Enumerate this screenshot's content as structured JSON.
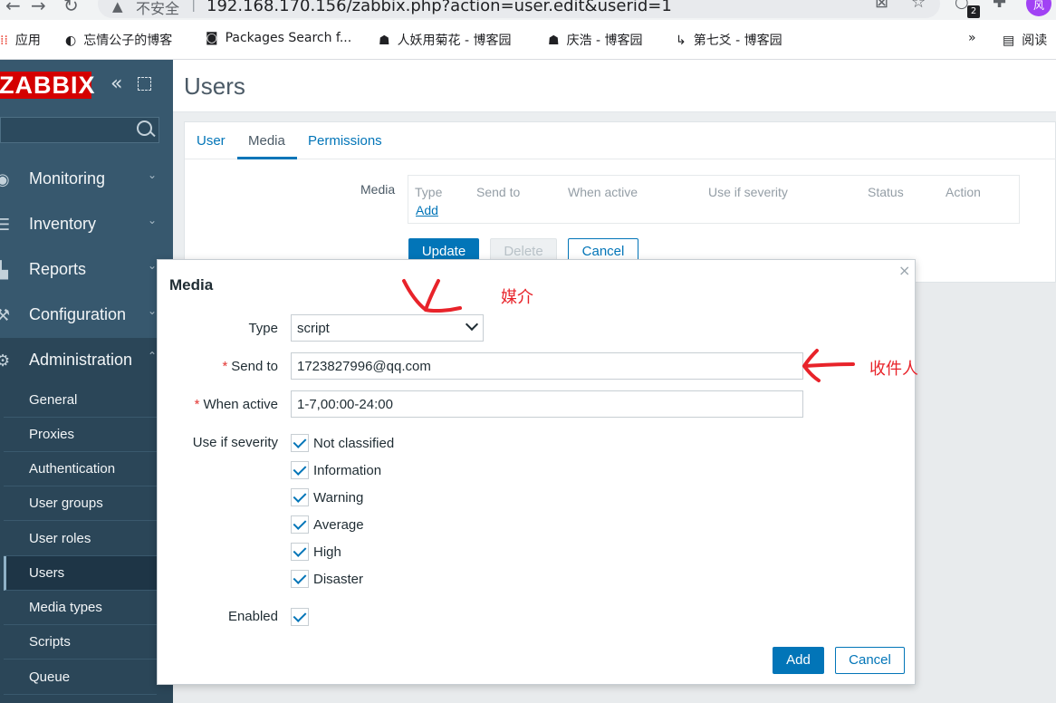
{
  "browser": {
    "insecure": "不安全",
    "url": "192.168.170.156/zabbix.php?action=user.edit&userid=1",
    "ext_badge": "2",
    "avatar": "风",
    "bookmarks": [
      {
        "label": "应用"
      },
      {
        "label": "忘情公子的博客"
      },
      {
        "label": "Packages Search f..."
      },
      {
        "label": "人妖用菊花 - 博客园"
      },
      {
        "label": "庆浩 - 博客园"
      },
      {
        "label": "第七爻 - 博客园"
      }
    ],
    "more": "»",
    "reading": "阅读"
  },
  "sidebar": {
    "logo": "ZABBIX",
    "menu": [
      {
        "label": "Monitoring"
      },
      {
        "label": "Inventory"
      },
      {
        "label": "Reports"
      },
      {
        "label": "Configuration"
      },
      {
        "label": "Administration"
      }
    ],
    "submenu": [
      {
        "label": "General"
      },
      {
        "label": "Proxies"
      },
      {
        "label": "Authentication"
      },
      {
        "label": "User groups"
      },
      {
        "label": "User roles"
      },
      {
        "label": "Users"
      },
      {
        "label": "Media types"
      },
      {
        "label": "Scripts"
      },
      {
        "label": "Queue"
      }
    ]
  },
  "page": {
    "title": "Users",
    "tabs": [
      "User",
      "Media",
      "Permissions"
    ],
    "media_label": "Media",
    "columns": [
      "Type",
      "Send to",
      "When active",
      "Use if severity",
      "Status",
      "Action"
    ],
    "add_link": "Add",
    "buttons": {
      "update": "Update",
      "delete": "Delete",
      "cancel": "Cancel"
    }
  },
  "dialog": {
    "title": "Media",
    "close": "×",
    "type_label": "Type",
    "type_value": "script",
    "sendto_label": "Send to",
    "sendto_value": "1723827996@qq.com",
    "when_label": "When active",
    "when_value": "1-7,00:00-24:00",
    "severity_label": "Use if severity",
    "severities": [
      {
        "label": "Not classified",
        "checked": true
      },
      {
        "label": "Information",
        "checked": true
      },
      {
        "label": "Warning",
        "checked": true
      },
      {
        "label": "Average",
        "checked": true
      },
      {
        "label": "High",
        "checked": true
      },
      {
        "label": "Disaster",
        "checked": true
      }
    ],
    "enabled_label": "Enabled",
    "enabled": true,
    "add": "Add",
    "cancel": "Cancel",
    "required_mark": "*"
  },
  "annotations": {
    "media": "媒介",
    "recipient": "收件人",
    "color": "#e8232a"
  }
}
